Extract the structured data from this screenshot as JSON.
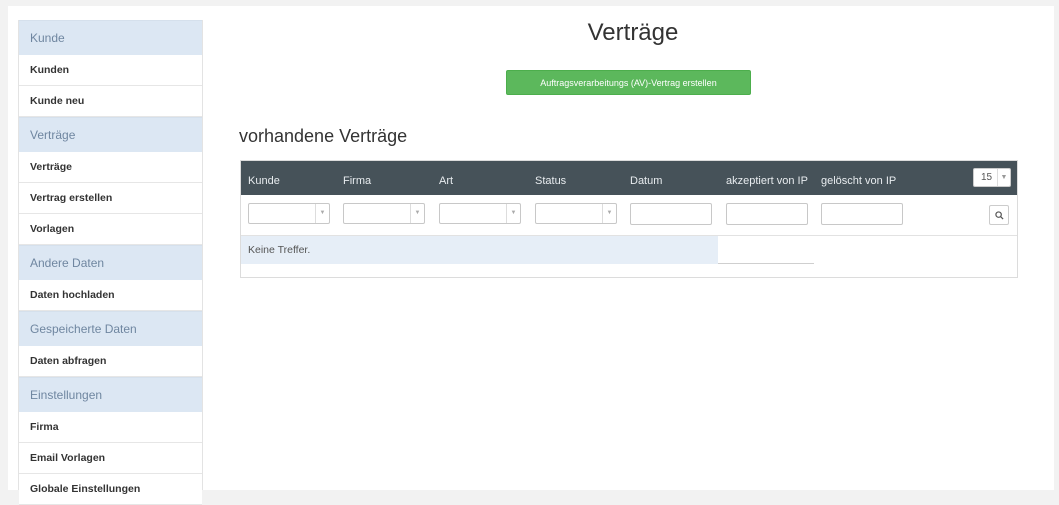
{
  "sidebar": {
    "sections": [
      {
        "heading": "Kunde",
        "items": [
          "Kunden",
          "Kunde neu"
        ]
      },
      {
        "heading": "Verträge",
        "items": [
          "Verträge",
          "Vertrag erstellen",
          "Vorlagen"
        ]
      },
      {
        "heading": "Andere Daten",
        "items": [
          "Daten hochladen"
        ]
      },
      {
        "heading": "Gespeicherte Daten",
        "items": [
          "Daten abfragen"
        ]
      },
      {
        "heading": "Einstellungen",
        "items": [
          "Firma",
          "Email Vorlagen",
          "Globale Einstellungen"
        ]
      }
    ]
  },
  "main": {
    "title": "Verträge",
    "av_button_label": "Auftragsverarbeitungs (AV)-Vertrag erstellen",
    "subtitle": "vorhandene Verträge",
    "table": {
      "columns": [
        "Kunde",
        "Firma",
        "Art",
        "Status",
        "Datum",
        "akzeptiert von IP",
        "gelöscht von IP"
      ],
      "page_size": "15",
      "empty_text": "Keine Treffer."
    }
  },
  "colors": {
    "accent": "#5cb85c",
    "table_header": "#465259",
    "sidebar_heading": "#dce7f3"
  },
  "icons": {
    "search_button": "search-icon",
    "dropdown": "chevron-down-icon"
  }
}
